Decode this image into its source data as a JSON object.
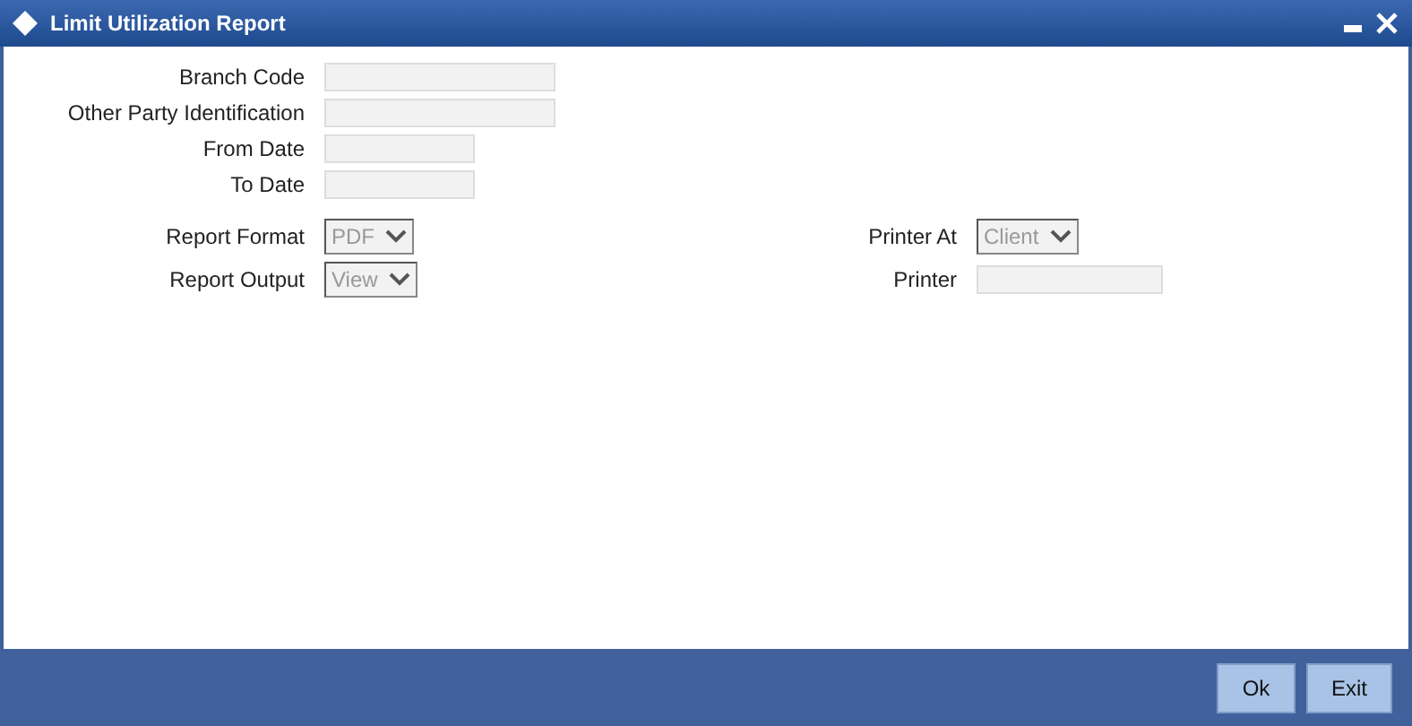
{
  "window": {
    "title": "Limit Utilization Report"
  },
  "fields": [
    {
      "label": "Branch Code",
      "kind": "text"
    },
    {
      "label": "Other Party Identification",
      "kind": "text"
    },
    {
      "label": "From Date",
      "kind": "date"
    },
    {
      "label": "To Date",
      "kind": "date"
    }
  ],
  "options": [
    [
      {
        "label": "Report Format",
        "kind": "select",
        "value": "PDF",
        "disabled": true
      },
      {
        "label": "Printer At",
        "kind": "select",
        "value": "Client",
        "disabled": true
      }
    ],
    [
      {
        "label": "Report Output",
        "kind": "select",
        "value": "View",
        "disabled": true
      },
      {
        "label": "Printer",
        "kind": "text"
      }
    ]
  ],
  "buttons": [
    "Ok",
    "Exit"
  ]
}
